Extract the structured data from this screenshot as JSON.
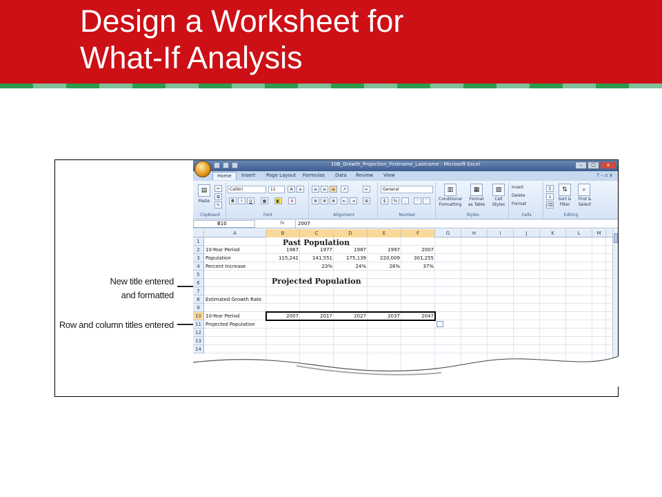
{
  "slide": {
    "title": "Design a Worksheet for\nWhat-If Analysis",
    "colors": {
      "header_red": "#cc1016",
      "stripe_green": "#2f9a4e",
      "stripe_light": "#7fc09a",
      "white": "#ffffff"
    }
  },
  "callouts": {
    "title_entered": "New title entered\nand formatted",
    "row_column_titles": "Row and column titles entered"
  },
  "excel": {
    "window_title": "10B_Growth_Projection_Firstname_Lastname - Microsoft Excel",
    "tabs": [
      "Home",
      "Insert",
      "Page Layout",
      "Formulas",
      "Data",
      "Review",
      "View"
    ],
    "ribbon": {
      "clipboard": {
        "label": "Clipboard",
        "paste": "Paste"
      },
      "font": {
        "label": "Font",
        "name": "Calibri",
        "size": "11",
        "bold": "B",
        "italic": "I",
        "underline": "U"
      },
      "alignment": {
        "label": "Alignment"
      },
      "number": {
        "label": "Number",
        "format": "General",
        "currency": "$",
        "percent": "%",
        "comma": ","
      },
      "styles": {
        "label": "Styles",
        "conditional": "Conditional\nFormatting",
        "format_table": "Format\nas Table",
        "cell_styles": "Cell\nStyles"
      },
      "cells": {
        "label": "Cells",
        "insert": "Insert",
        "delete": "Delete",
        "format": "Format"
      },
      "editing": {
        "label": "Editing",
        "sort": "Sort &\nFilter",
        "find": "Find &\nSelect"
      }
    },
    "formula_bar": {
      "name_box": "B10",
      "fx": "fx",
      "value": "2007"
    },
    "columns": [
      "A",
      "B",
      "C",
      "D",
      "E",
      "F",
      "G",
      "H",
      "I",
      "J",
      "K",
      "L",
      "M"
    ],
    "selected_columns": [
      "B",
      "C",
      "D",
      "E",
      "F"
    ],
    "rows": [
      "1",
      "2",
      "3",
      "4",
      "5",
      "6",
      "7",
      "8",
      "9",
      "10",
      "11",
      "12",
      "13",
      "14"
    ],
    "selected_row": "10",
    "sheet": {
      "title_past": "Past Population",
      "title_projected": "Projected Population",
      "row2": {
        "label": "10-Year Period",
        "values": [
          "1967",
          "1977",
          "1987",
          "1997",
          "2007"
        ]
      },
      "row3": {
        "label": "Population",
        "values": [
          "115,241",
          "141,551",
          "175,139",
          "220,009",
          "301,255"
        ]
      },
      "row4": {
        "label": "Percent Increase",
        "values": [
          "",
          "23%",
          "24%",
          "26%",
          "37%"
        ]
      },
      "row8": {
        "label": "Estimated Growth Rate"
      },
      "row10": {
        "label": "10-Year Period",
        "values": [
          "2007",
          "2017",
          "2027",
          "2037",
          "2047"
        ]
      },
      "row11": {
        "label": "Projected Population"
      }
    }
  }
}
